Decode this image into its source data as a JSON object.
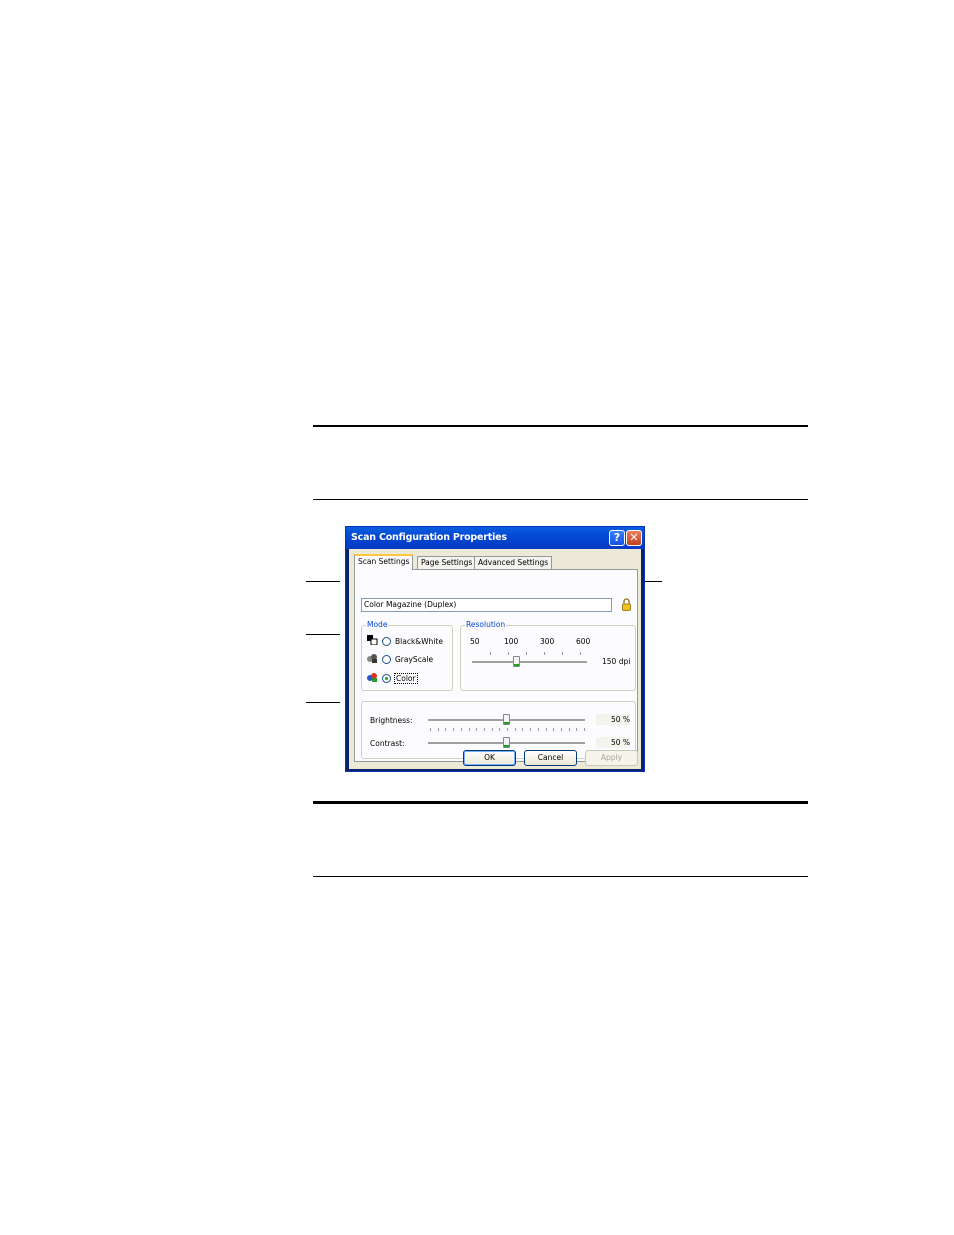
{
  "window": {
    "title": "Scan Configuration Properties",
    "help_glyph": "?",
    "close_glyph": "✕"
  },
  "tabs": [
    {
      "label": "Scan Settings",
      "active": true
    },
    {
      "label": "Page Settings",
      "active": false
    },
    {
      "label": "Advanced Settings",
      "active": false
    }
  ],
  "config_name": "Color Magazine (Duplex)",
  "lock_icon": "lock-icon",
  "mode": {
    "label": "Mode",
    "options": [
      {
        "label": "Black&White",
        "selected": false,
        "icon": "black-white-icon"
      },
      {
        "label": "GrayScale",
        "selected": false,
        "icon": "grayscale-icon"
      },
      {
        "label": "Color",
        "selected": true,
        "icon": "color-icon"
      }
    ]
  },
  "resolution": {
    "label": "Resolution",
    "ticks": [
      "50",
      "100",
      "300",
      "600"
    ],
    "value_label": "150 dpi",
    "value": 150
  },
  "brightness": {
    "label": "Brightness:",
    "value_label": "50 %",
    "value": 50
  },
  "contrast": {
    "label": "Contrast:",
    "value_label": "50 %",
    "value": 50
  },
  "buttons": {
    "ok": "OK",
    "cancel": "Cancel",
    "apply": "Apply"
  },
  "colors": {
    "titlebar": "#0448d4",
    "dialog_bg": "#ece9d8",
    "accent": "#21a121",
    "tab_highlight": "#ffc73c"
  }
}
